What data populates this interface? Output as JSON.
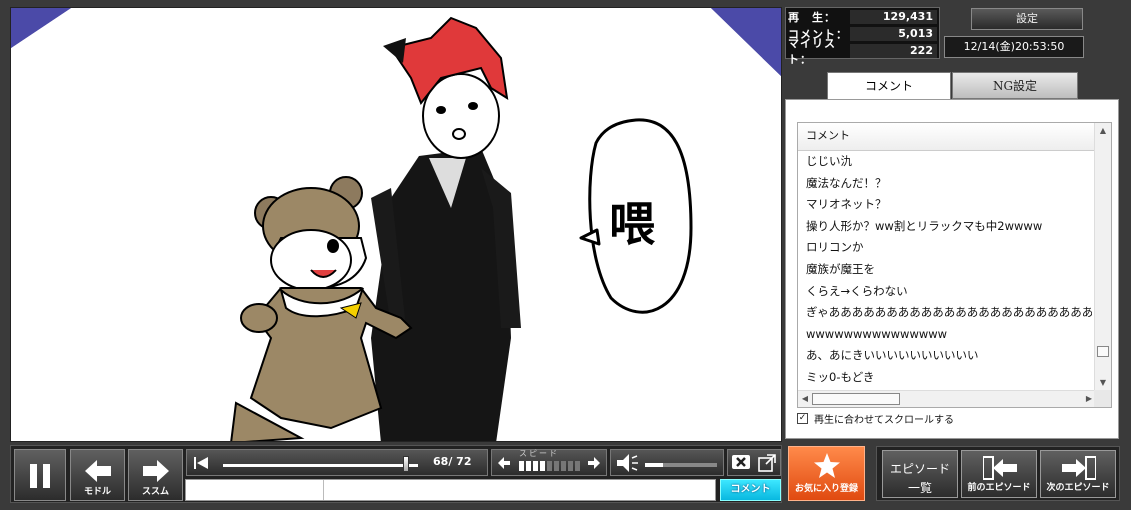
{
  "stats": {
    "plays_label": "再　生：",
    "plays_value": "129,431",
    "comments_label": "コメント：",
    "comments_value": "5,013",
    "mylist_label": "マイリスト：",
    "mylist_value": "222"
  },
  "settings_label": "設定",
  "datetime": "12/14(金)20:53:50",
  "tabs": {
    "comment": "コメント",
    "ng": "NG設定"
  },
  "comment_list": {
    "header": "コメント",
    "items": [
      "じじい氿",
      "魔法なんだ！？",
      "マリオネット？",
      "操り人形か？ww割とリラックマも中2wwww",
      "ロリコンか",
      "魔族が魔王を",
      "くらえ→くらわない",
      "ぎゃああああああああああああああああああああああああ",
      "wwwwwwwwwwwwwww",
      "あ、あにきいいいいいいいいいい",
      "ミッ0-もどき"
    ],
    "autoscroll_label": "再生に合わせてスクロールする",
    "autoscroll_checked": true
  },
  "video": {
    "speech_text": "喂",
    "bg_color": "#4b4aa8",
    "hair_color": "#e0393a"
  },
  "controls": {
    "back_label": "モドル",
    "forward_label": "ススム",
    "time_current": "68",
    "time_total": "72",
    "speed_label": "スピード",
    "speed_level": 4,
    "speed_max": 9,
    "volume_fraction": 0.25,
    "seek_fraction": 0.94,
    "comment_button": "コメント"
  },
  "favorite_label": "お気に入り登録",
  "episodes": {
    "list_label_line1": "エピソード",
    "list_label_line2": "一覧",
    "prev_label": "前のエピソード",
    "next_label": "次のエピソード"
  }
}
